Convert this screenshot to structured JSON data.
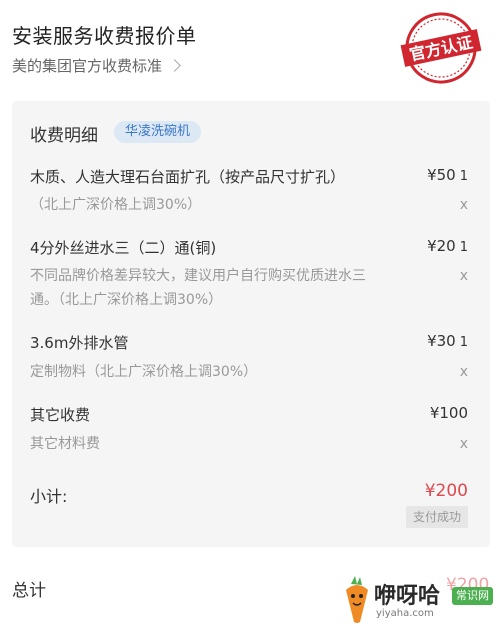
{
  "header": {
    "title": "安装服务收费报价单",
    "subtitle": "美的集团官方收费标准",
    "stamp_text": "官方认证"
  },
  "details": {
    "title": "收费明细",
    "tag": "华凌洗碗机",
    "items": [
      {
        "name": "木质、人造大理石台面扩孔（按产品尺寸扩孔）",
        "price": "¥50",
        "qty": "1",
        "note": "（北上广深价格上调30%）",
        "mult": "x"
      },
      {
        "name": "4分外丝进水三（二）通(铜)",
        "price": "¥20",
        "qty": "1",
        "note": "不同品牌价格差异较大，建议用户自行购买优质进水三通。（北上广深价格上调30%）",
        "mult": "x"
      },
      {
        "name": "3.6m外排水管",
        "price": "¥30",
        "qty": "1",
        "note": "定制物料（北上广深价格上调30%）",
        "mult": "x"
      },
      {
        "name": "其它收费",
        "price": "¥100",
        "qty": "",
        "note": "其它材料费",
        "mult": "x"
      }
    ],
    "subtotal_label": "小计:",
    "subtotal_value": "¥200",
    "paid_label": "支付成功"
  },
  "total": {
    "label": "总计",
    "value": "¥200"
  },
  "watermark": {
    "text": "咿呀哈",
    "badge": "常识网",
    "url": "yiyaha.com"
  },
  "colors": {
    "accent_red": "#e0484f",
    "tag_blue": "#3a78c9",
    "stamp_red": "#d0262f"
  },
  "icons": {
    "chevron": "chevron-right-icon",
    "watermark_logo": "carrot-mascot-icon"
  }
}
